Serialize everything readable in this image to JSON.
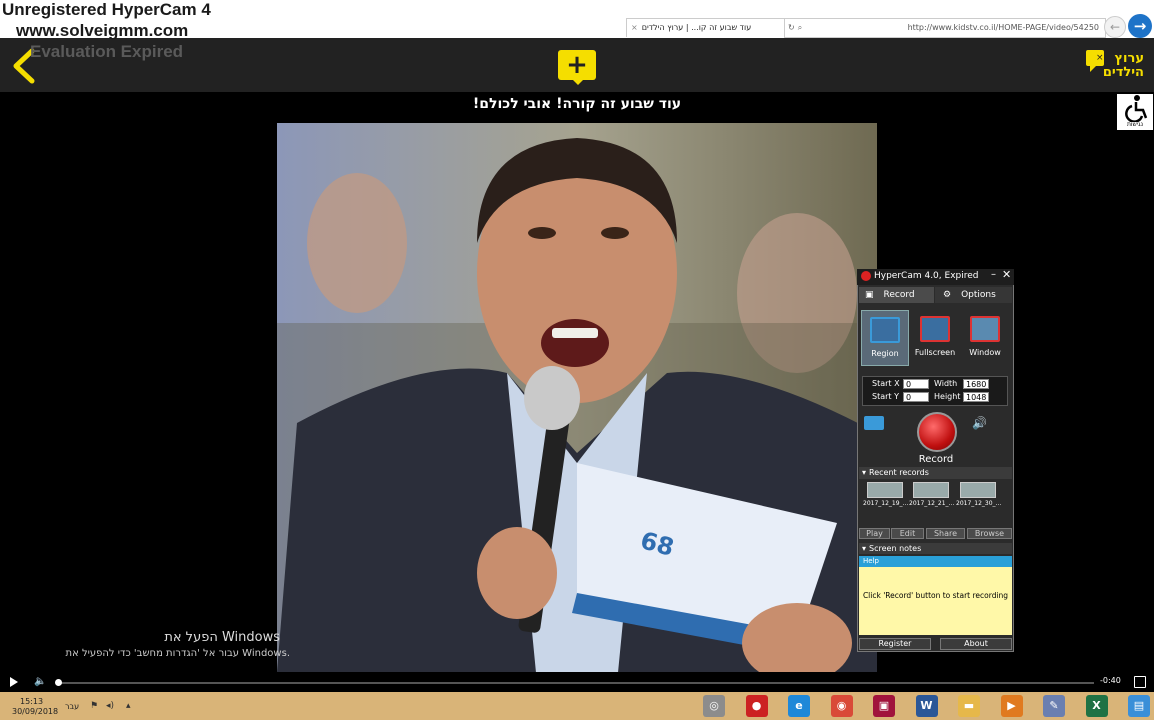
{
  "watermark": {
    "line1": "Unregistered HyperCam 4",
    "line2": "www.solveigmm.com",
    "line3": "Evaluation Expired"
  },
  "browser": {
    "address": "http://www.kidstv.co.il/HOME-PAGE/video/54250",
    "tab_title": "עוד שבוע זה קו... | ערוץ הילדים"
  },
  "site": {
    "logo_text": "ערוץ הילדים",
    "accessibility_label": "נגישות"
  },
  "video": {
    "title": "עוד שבוע זה קורה! אובי לכולם!",
    "time_remaining": "-0:40",
    "progress": 0.003
  },
  "windows_activation": {
    "title": "הפעל את Windows",
    "subtitle": "עבור אל 'הגדרות מחשב' כדי להפעיל את Windows."
  },
  "taskbar": {
    "time": "15:13",
    "date": "30/09/2018",
    "language": "עבר",
    "apps": [
      {
        "name": "app-disc-icon",
        "color": "#8c8c8c",
        "glyph": "◎"
      },
      {
        "name": "hypercam-taskbar-icon",
        "color": "#c22",
        "glyph": "●"
      },
      {
        "name": "ie-icon",
        "color": "#1e88d8",
        "glyph": "e"
      },
      {
        "name": "chrome-icon",
        "color": "#d94a38",
        "glyph": "◉"
      },
      {
        "name": "media-icon",
        "color": "#a0133c",
        "glyph": "▣"
      },
      {
        "name": "word-icon",
        "color": "#2b5797",
        "glyph": "W"
      },
      {
        "name": "folder-icon",
        "color": "#e6b84a",
        "glyph": "▬"
      },
      {
        "name": "player-icon",
        "color": "#e07a1f",
        "glyph": "▶"
      },
      {
        "name": "paint-icon",
        "color": "#6a7fb0",
        "glyph": "✎"
      },
      {
        "name": "excel-icon",
        "color": "#1f7244",
        "glyph": "X"
      },
      {
        "name": "explorer-icon",
        "color": "#3a8fd8",
        "glyph": "▤"
      }
    ]
  },
  "hypercam": {
    "title": "HyperCam 4.0, Expired",
    "tabs": {
      "record": "Record",
      "options": "Options"
    },
    "modes": {
      "region": "Region",
      "fullscreen": "Fullscreen",
      "window": "Window"
    },
    "coords": {
      "start_x_label": "Start X",
      "start_x": "0",
      "start_y_label": "Start Y",
      "start_y": "0",
      "width_label": "Width",
      "width": "1680",
      "height_label": "Height",
      "height": "1048"
    },
    "record_label": "Record",
    "recent_header": "Recent records",
    "recent": [
      "2017_12_19_...",
      "2017_12_21_...",
      "2017_12_30_..."
    ],
    "actions": {
      "play": "Play",
      "edit": "Edit",
      "share": "Share",
      "browse": "Browse"
    },
    "notes_header": "Screen notes",
    "help_label": "Help",
    "help_text": "Click 'Record' button to start recording",
    "register": "Register",
    "about": "About"
  }
}
